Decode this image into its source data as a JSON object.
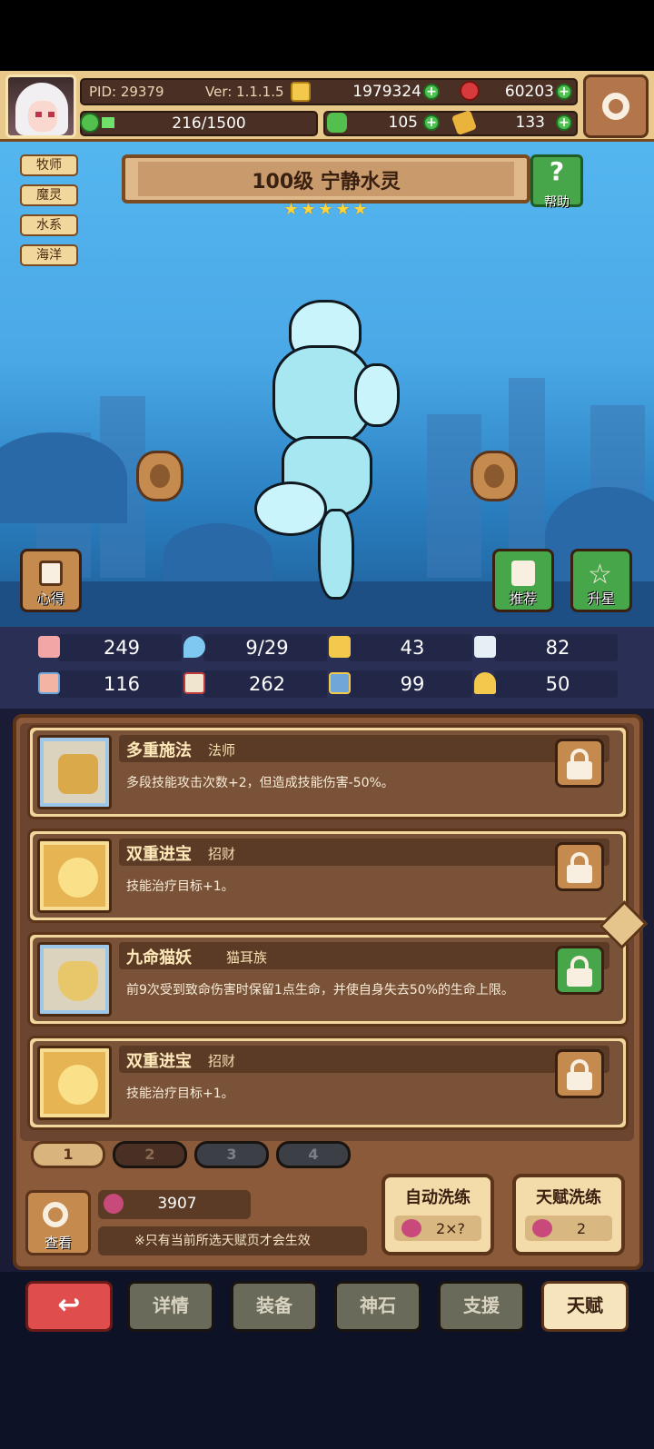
{
  "header": {
    "pid": "PID: 29379",
    "version": "Ver: 1.1.1.5",
    "gold": "1979324",
    "gems": "60203",
    "exp": "216/1500",
    "exp_fraction": 0.144,
    "clover": "105",
    "tickets": "133"
  },
  "tags": [
    "牧师",
    "魔灵",
    "水系",
    "海洋"
  ],
  "hero": {
    "title": "100级  宁静水灵",
    "stars": 5,
    "help_label": "帮助"
  },
  "side_buttons": {
    "left": "心得",
    "recommend": "推荐",
    "star_up": "升星"
  },
  "stats": [
    {
      "icon": "heart-icon",
      "value": "249"
    },
    {
      "icon": "droplet-icon",
      "value": "9/29"
    },
    {
      "icon": "shield-icon",
      "value": "43"
    },
    {
      "icon": "wing-icon",
      "value": "82"
    },
    {
      "icon": "fist-icon",
      "value": "116"
    },
    {
      "icon": "book-icon",
      "value": "262"
    },
    {
      "icon": "boot-icon",
      "value": "99"
    },
    {
      "icon": "horseshoe-icon",
      "value": "50"
    }
  ],
  "talents": [
    {
      "name": "多重施法",
      "tag": "法师",
      "desc": "多段技能攻击次数+2，但造成技能伤害-50%。",
      "lock": "unlocked",
      "icon": "staff-icon"
    },
    {
      "name": "双重进宝",
      "tag": "招财",
      "desc": "技能治疗目标+1。",
      "lock": "unlocked",
      "icon": "star-icon"
    },
    {
      "name": "九命猫妖",
      "tag": "猫耳族",
      "desc": "前9次受到致命伤害时保留1点生命，并使自身失去50%的生命上限。",
      "lock": "locked",
      "icon": "cat-icon"
    },
    {
      "name": "双重进宝",
      "tag": "招财",
      "desc": "技能治疗目标+1。",
      "lock": "unlocked",
      "icon": "star-icon"
    }
  ],
  "pages": [
    "1",
    "2",
    "3",
    "4"
  ],
  "footer": {
    "view_label": "查看",
    "fruit_count": "3907",
    "note": "※只有当前所选天赋页才会生效",
    "auto_reroll": {
      "label": "自动洗练",
      "cost": "2×?"
    },
    "talent_reroll": {
      "label": "天赋洗练",
      "cost": "2"
    }
  },
  "nav": {
    "back": "↩",
    "detail": "详情",
    "equip": "装备",
    "stone": "神石",
    "support": "支援",
    "talent": "天赋"
  }
}
